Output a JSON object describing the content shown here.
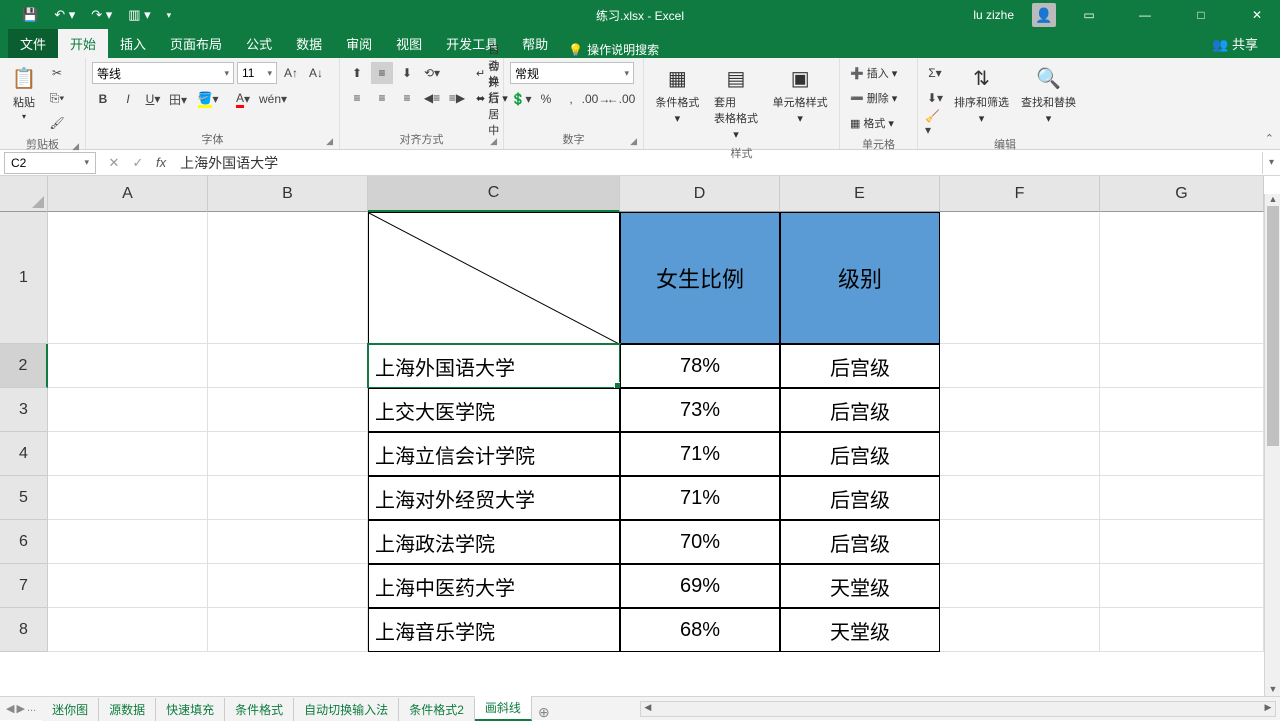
{
  "title": {
    "filename": "练习.xlsx",
    "sep": " - ",
    "app": "Excel"
  },
  "user": "lu zizhe",
  "tabs": {
    "file": "文件",
    "start": "开始",
    "insert": "插入",
    "pagelayout": "页面布局",
    "formula": "公式",
    "data": "数据",
    "review": "审阅",
    "view": "视图",
    "devtools": "开发工具",
    "help": "帮助",
    "tellme": "操作说明搜索",
    "share": "共享"
  },
  "ribbon": {
    "clipboard": {
      "paste": "粘贴",
      "label": "剪贴板"
    },
    "font": {
      "name": "等线",
      "size": "11",
      "label": "字体"
    },
    "align": {
      "wrap": "自动换行",
      "merge": "合并后居中",
      "label": "对齐方式"
    },
    "number": {
      "format": "常规",
      "label": "数字"
    },
    "styles": {
      "cond": "条件格式",
      "table": "套用\n表格格式",
      "cell": "单元格样式",
      "label": "样式"
    },
    "cells": {
      "insert": "插入",
      "delete": "删除",
      "format": "格式",
      "label": "单元格"
    },
    "editing": {
      "sort": "排序和筛选",
      "find": "查找和替换",
      "label": "编辑"
    }
  },
  "namebox": "C2",
  "formula": "上海外国语大学",
  "colWidths": {
    "A": 160,
    "B": 160,
    "C": 252,
    "D": 160,
    "E": 160,
    "F": 160,
    "G": 164
  },
  "headers": {
    "A": "A",
    "B": "B",
    "C": "C",
    "D": "D",
    "E": "E",
    "F": "F",
    "G": "G"
  },
  "rowLabels": [
    "1",
    "2",
    "3",
    "4",
    "5",
    "6",
    "7",
    "8"
  ],
  "tableHeaders": {
    "d": "女生比例",
    "e": "级别"
  },
  "rows": [
    {
      "name": "上海外国语大学",
      "pct": "78%",
      "level": "后宫级"
    },
    {
      "name": "上交大医学院",
      "pct": "73%",
      "level": "后宫级"
    },
    {
      "name": "上海立信会计学院",
      "pct": "71%",
      "level": "后宫级"
    },
    {
      "name": "上海对外经贸大学",
      "pct": "71%",
      "level": "后宫级"
    },
    {
      "name": "上海政法学院",
      "pct": "70%",
      "level": "后宫级"
    },
    {
      "name": "上海中医药大学",
      "pct": "69%",
      "level": "天堂级"
    },
    {
      "name": "上海音乐学院",
      "pct": "68%",
      "level": "天堂级"
    }
  ],
  "sheets": {
    "mini": "迷你图",
    "src": "源数据",
    "fill": "快速填充",
    "cf": "条件格式",
    "auto": "自动切换输入法",
    "cf2": "条件格式2",
    "diag": "画斜线",
    "ellipsis": "..."
  }
}
